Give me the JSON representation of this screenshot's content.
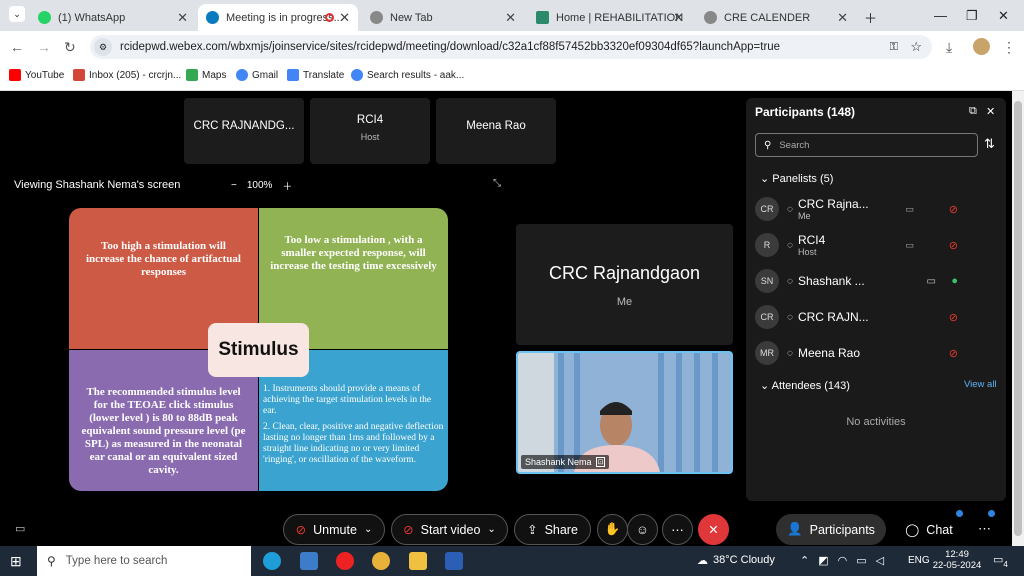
{
  "tabs": [
    {
      "label": "(1) WhatsApp"
    },
    {
      "label": "Meeting is in progress..."
    },
    {
      "label": "New Tab"
    },
    {
      "label": "Home | REHABILITATION CO"
    },
    {
      "label": "CRE CALENDER"
    }
  ],
  "address": {
    "url": "rcidepwd.webex.com/wbxmjs/joinservice/sites/rcidepwd/meeting/download/c32a1cf88f57452bb3320ef09304df65?launchApp=true"
  },
  "bookmarks": [
    "YouTube",
    "Inbox (205) - crcrjn...",
    "Maps",
    "Gmail",
    "Translate",
    "Search results - aak..."
  ],
  "meeting": {
    "top_tiles": [
      {
        "name": "CRC RAJNANDG...",
        "sub": ""
      },
      {
        "name": "RCI4",
        "sub": "Host"
      },
      {
        "name": "Meena Rao",
        "sub": ""
      }
    ],
    "viewing": "Viewing Shashank Nema's screen",
    "zoom": "100%",
    "slide": {
      "q1": "Too high a stimulation will increase the chance of artifactual responses",
      "q2": "Too low a stimulation , with a smaller expected response, will increase the testing time excessively",
      "q3": "The recommended stimulus level for the TEOAE click stimulus (lower level ) is 80 to 88dB peak equivalent sound pressure level (pe SPL) as measured in the neonatal ear canal or an equivalent sized cavity.",
      "q4a": "1. Instruments should provide a means of achieving the target stimulation levels in the ear.",
      "q4b": "2. Clean, clear, positive and negative deflection lasting no longer than 1ms and followed by a straight line indicating no or very limited 'ringing', or oscillation of the waveform.",
      "center": "Stimulus",
      "colors": {
        "q1": "#cc5a45",
        "q2": "#92b354",
        "q3": "#8a6bb0",
        "q4": "#3aa3cf"
      }
    },
    "self_tile": {
      "name": "CRC Rajnandgaon",
      "sub": "Me"
    },
    "video_label": "Shashank Nema"
  },
  "panel": {
    "title": "Participants (148)",
    "search_placeholder": "Search",
    "panelists_header": "Panelists (5)",
    "panelists": [
      {
        "initials": "CR",
        "name": "CRC Rajna...",
        "sub": "Me"
      },
      {
        "initials": "R",
        "name": "RCI4",
        "sub": "Host"
      },
      {
        "initials": "SN",
        "name": "Shashank ...",
        "sub": ""
      },
      {
        "initials": "CR",
        "name": "CRC RAJN...",
        "sub": ""
      },
      {
        "initials": "MR",
        "name": "Meena Rao",
        "sub": ""
      }
    ],
    "attendees_header": "Attendees (143)",
    "view_all": "View all",
    "no_activities": "No activities"
  },
  "controls": {
    "unmute": "Unmute",
    "start_video": "Start video",
    "share": "Share",
    "participants": "Participants",
    "chat": "Chat"
  },
  "taskbar": {
    "search_placeholder": "Type here to search",
    "weather": "38°C  Cloudy",
    "lang": "ENG",
    "time": "12:49",
    "date": "22-05-2024",
    "notif": "4"
  }
}
